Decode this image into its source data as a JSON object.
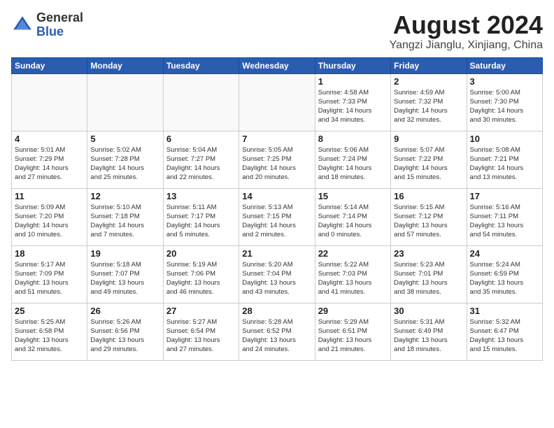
{
  "header": {
    "logo_general": "General",
    "logo_blue": "Blue",
    "month_title": "August 2024",
    "subtitle": "Yangzi Jianglu, Xinjiang, China"
  },
  "days_of_week": [
    "Sunday",
    "Monday",
    "Tuesday",
    "Wednesday",
    "Thursday",
    "Friday",
    "Saturday"
  ],
  "weeks": [
    [
      {
        "day": "",
        "info": ""
      },
      {
        "day": "",
        "info": ""
      },
      {
        "day": "",
        "info": ""
      },
      {
        "day": "",
        "info": ""
      },
      {
        "day": "1",
        "info": "Sunrise: 4:58 AM\nSunset: 7:33 PM\nDaylight: 14 hours\nand 34 minutes."
      },
      {
        "day": "2",
        "info": "Sunrise: 4:59 AM\nSunset: 7:32 PM\nDaylight: 14 hours\nand 32 minutes."
      },
      {
        "day": "3",
        "info": "Sunrise: 5:00 AM\nSunset: 7:30 PM\nDaylight: 14 hours\nand 30 minutes."
      }
    ],
    [
      {
        "day": "4",
        "info": "Sunrise: 5:01 AM\nSunset: 7:29 PM\nDaylight: 14 hours\nand 27 minutes."
      },
      {
        "day": "5",
        "info": "Sunrise: 5:02 AM\nSunset: 7:28 PM\nDaylight: 14 hours\nand 25 minutes."
      },
      {
        "day": "6",
        "info": "Sunrise: 5:04 AM\nSunset: 7:27 PM\nDaylight: 14 hours\nand 22 minutes."
      },
      {
        "day": "7",
        "info": "Sunrise: 5:05 AM\nSunset: 7:25 PM\nDaylight: 14 hours\nand 20 minutes."
      },
      {
        "day": "8",
        "info": "Sunrise: 5:06 AM\nSunset: 7:24 PM\nDaylight: 14 hours\nand 18 minutes."
      },
      {
        "day": "9",
        "info": "Sunrise: 5:07 AM\nSunset: 7:22 PM\nDaylight: 14 hours\nand 15 minutes."
      },
      {
        "day": "10",
        "info": "Sunrise: 5:08 AM\nSunset: 7:21 PM\nDaylight: 14 hours\nand 13 minutes."
      }
    ],
    [
      {
        "day": "11",
        "info": "Sunrise: 5:09 AM\nSunset: 7:20 PM\nDaylight: 14 hours\nand 10 minutes."
      },
      {
        "day": "12",
        "info": "Sunrise: 5:10 AM\nSunset: 7:18 PM\nDaylight: 14 hours\nand 7 minutes."
      },
      {
        "day": "13",
        "info": "Sunrise: 5:11 AM\nSunset: 7:17 PM\nDaylight: 14 hours\nand 5 minutes."
      },
      {
        "day": "14",
        "info": "Sunrise: 5:13 AM\nSunset: 7:15 PM\nDaylight: 14 hours\nand 2 minutes."
      },
      {
        "day": "15",
        "info": "Sunrise: 5:14 AM\nSunset: 7:14 PM\nDaylight: 14 hours\nand 0 minutes."
      },
      {
        "day": "16",
        "info": "Sunrise: 5:15 AM\nSunset: 7:12 PM\nDaylight: 13 hours\nand 57 minutes."
      },
      {
        "day": "17",
        "info": "Sunrise: 5:16 AM\nSunset: 7:11 PM\nDaylight: 13 hours\nand 54 minutes."
      }
    ],
    [
      {
        "day": "18",
        "info": "Sunrise: 5:17 AM\nSunset: 7:09 PM\nDaylight: 13 hours\nand 51 minutes."
      },
      {
        "day": "19",
        "info": "Sunrise: 5:18 AM\nSunset: 7:07 PM\nDaylight: 13 hours\nand 49 minutes."
      },
      {
        "day": "20",
        "info": "Sunrise: 5:19 AM\nSunset: 7:06 PM\nDaylight: 13 hours\nand 46 minutes."
      },
      {
        "day": "21",
        "info": "Sunrise: 5:20 AM\nSunset: 7:04 PM\nDaylight: 13 hours\nand 43 minutes."
      },
      {
        "day": "22",
        "info": "Sunrise: 5:22 AM\nSunset: 7:03 PM\nDaylight: 13 hours\nand 41 minutes."
      },
      {
        "day": "23",
        "info": "Sunrise: 5:23 AM\nSunset: 7:01 PM\nDaylight: 13 hours\nand 38 minutes."
      },
      {
        "day": "24",
        "info": "Sunrise: 5:24 AM\nSunset: 6:59 PM\nDaylight: 13 hours\nand 35 minutes."
      }
    ],
    [
      {
        "day": "25",
        "info": "Sunrise: 5:25 AM\nSunset: 6:58 PM\nDaylight: 13 hours\nand 32 minutes."
      },
      {
        "day": "26",
        "info": "Sunrise: 5:26 AM\nSunset: 6:56 PM\nDaylight: 13 hours\nand 29 minutes."
      },
      {
        "day": "27",
        "info": "Sunrise: 5:27 AM\nSunset: 6:54 PM\nDaylight: 13 hours\nand 27 minutes."
      },
      {
        "day": "28",
        "info": "Sunrise: 5:28 AM\nSunset: 6:52 PM\nDaylight: 13 hours\nand 24 minutes."
      },
      {
        "day": "29",
        "info": "Sunrise: 5:29 AM\nSunset: 6:51 PM\nDaylight: 13 hours\nand 21 minutes."
      },
      {
        "day": "30",
        "info": "Sunrise: 5:31 AM\nSunset: 6:49 PM\nDaylight: 13 hours\nand 18 minutes."
      },
      {
        "day": "31",
        "info": "Sunrise: 5:32 AM\nSunset: 6:47 PM\nDaylight: 13 hours\nand 15 minutes."
      }
    ]
  ]
}
